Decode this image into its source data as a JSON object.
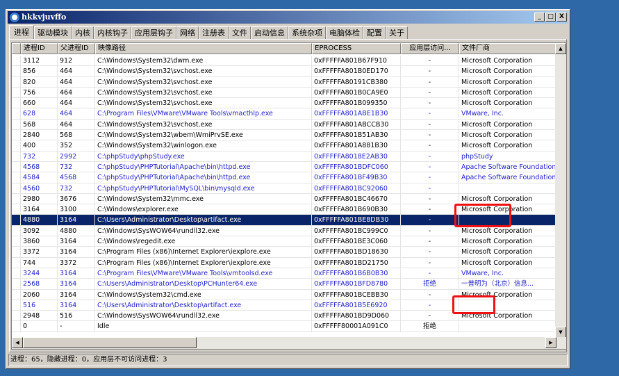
{
  "window": {
    "title": "hkkvjuvffo",
    "minimize": "_",
    "maximize": "□",
    "close": "X"
  },
  "tabs": [
    "进程",
    "驱动模块",
    "内核",
    "内核钩子",
    "应用层钩子",
    "网络",
    "注册表",
    "文件",
    "启动信息",
    "系统杂项",
    "电脑体检",
    "配置",
    "关于"
  ],
  "active_tab": 0,
  "columns": [
    "",
    "进程ID",
    "父进程ID",
    "映像路径",
    "EPROCESS",
    "应用层访问...",
    "文件厂商"
  ],
  "rows": [
    {
      "pid": "3112",
      "ppid": "912",
      "path": "C:\\Windows\\System32\\dwm.exe",
      "eprocess": "0xFFFFFA801B67F910",
      "access": "-",
      "vendor": "Microsoft Corporation",
      "style": ""
    },
    {
      "pid": "856",
      "ppid": "464",
      "path": "C:\\Windows\\System32\\svchost.exe",
      "eprocess": "0xFFFFFA801B0ED170",
      "access": "-",
      "vendor": "Microsoft Corporation",
      "style": ""
    },
    {
      "pid": "820",
      "ppid": "464",
      "path": "C:\\Windows\\System32\\svchost.exe",
      "eprocess": "0xFFFFFA80191CB380",
      "access": "-",
      "vendor": "Microsoft Corporation",
      "style": ""
    },
    {
      "pid": "756",
      "ppid": "464",
      "path": "C:\\Windows\\System32\\svchost.exe",
      "eprocess": "0xFFFFFA801B0CA9E0",
      "access": "-",
      "vendor": "Microsoft Corporation",
      "style": ""
    },
    {
      "pid": "660",
      "ppid": "464",
      "path": "C:\\Windows\\System32\\svchost.exe",
      "eprocess": "0xFFFFFA801B099350",
      "access": "-",
      "vendor": "Microsoft Corporation",
      "style": ""
    },
    {
      "pid": "628",
      "ppid": "464",
      "path": "C:\\Program Files\\VMware\\VMware Tools\\vmacthlp.exe",
      "eprocess": "0xFFFFFA801ABE1B30",
      "access": "-",
      "vendor": "VMware, Inc.",
      "style": "blue"
    },
    {
      "pid": "568",
      "ppid": "464",
      "path": "C:\\Windows\\System32\\svchost.exe",
      "eprocess": "0xFFFFFA801ABCCB30",
      "access": "-",
      "vendor": "Microsoft Corporation",
      "style": ""
    },
    {
      "pid": "2840",
      "ppid": "568",
      "path": "C:\\Windows\\System32\\wbem\\WmiPrvSE.exe",
      "eprocess": "0xFFFFFA801B51AB30",
      "access": "-",
      "vendor": "Microsoft Corporation",
      "style": ""
    },
    {
      "pid": "400",
      "ppid": "352",
      "path": "C:\\Windows\\System32\\winlogon.exe",
      "eprocess": "0xFFFFFA801A881B30",
      "access": "-",
      "vendor": "Microsoft Corporation",
      "style": ""
    },
    {
      "pid": "732",
      "ppid": "2992",
      "path": "C:\\phpStudy\\phpStudy.exe",
      "eprocess": "0xFFFFFA8018E2AB30",
      "access": "-",
      "vendor": "phpStudy",
      "style": "blue"
    },
    {
      "pid": "4568",
      "ppid": "732",
      "path": "C:\\phpStudy\\PHPTutorial\\Apache\\bin\\httpd.exe",
      "eprocess": "0xFFFFFA801BDFC060",
      "access": "-",
      "vendor": "Apache Software Foundation",
      "style": "blue"
    },
    {
      "pid": "4584",
      "ppid": "4568",
      "path": "C:\\phpStudy\\PHPTutorial\\Apache\\bin\\httpd.exe",
      "eprocess": "0xFFFFFA801BF49B30",
      "access": "-",
      "vendor": "Apache Software Foundation",
      "style": "blue"
    },
    {
      "pid": "4560",
      "ppid": "732",
      "path": "C:\\phpStudy\\PHPTutorial\\MySQL\\bin\\mysqld.exe",
      "eprocess": "0xFFFFFA801BC92060",
      "access": "-",
      "vendor": "",
      "style": "blue"
    },
    {
      "pid": "2980",
      "ppid": "3676",
      "path": "C:\\Windows\\System32\\mmc.exe",
      "eprocess": "0xFFFFFA801BC46670",
      "access": "-",
      "vendor": "Microsoft Corporation",
      "style": ""
    },
    {
      "pid": "3164",
      "ppid": "3100",
      "path": "C:\\Windows\\explorer.exe",
      "eprocess": "0xFFFFFA801B690B30",
      "access": "-",
      "vendor": "Microsoft Corporation",
      "style": ""
    },
    {
      "pid": "4880",
      "ppid": "3164",
      "path": "C:\\Users\\Administrator\\Desktop\\artifact.exe",
      "eprocess": "0xFFFFFA801BE8DB30",
      "access": "-",
      "vendor": "",
      "style": "sel"
    },
    {
      "pid": "3092",
      "ppid": "4880",
      "path": "C:\\Windows\\SysWOW64\\rundll32.exe",
      "eprocess": "0xFFFFFA801BC999C0",
      "access": "-",
      "vendor": "Microsoft Corporation",
      "style": ""
    },
    {
      "pid": "3860",
      "ppid": "3164",
      "path": "C:\\Windows\\regedit.exe",
      "eprocess": "0xFFFFFA801BE3C060",
      "access": "-",
      "vendor": "Microsoft Corporation",
      "style": ""
    },
    {
      "pid": "3372",
      "ppid": "3164",
      "path": "C:\\Program Files (x86)\\Internet Explorer\\iexplore.exe",
      "eprocess": "0xFFFFFA801BD18630",
      "access": "-",
      "vendor": "Microsoft Corporation",
      "style": ""
    },
    {
      "pid": "744",
      "ppid": "3372",
      "path": "C:\\Program Files (x86)\\Internet Explorer\\iexplore.exe",
      "eprocess": "0xFFFFFA801BD21750",
      "access": "-",
      "vendor": "Microsoft Corporation",
      "style": ""
    },
    {
      "pid": "3244",
      "ppid": "3164",
      "path": "C:\\Program Files\\VMware\\VMware Tools\\vmtoolsd.exe",
      "eprocess": "0xFFFFFA801B6B0B30",
      "access": "-",
      "vendor": "VMware, Inc.",
      "style": "blue"
    },
    {
      "pid": "2568",
      "ppid": "3164",
      "path": "C:\\Users\\Administrator\\Desktop\\PCHunter64.exe",
      "eprocess": "0xFFFFFA801BFD8780",
      "access": "拒绝",
      "vendor": "一普明为（北京）信息...",
      "style": "blue"
    },
    {
      "pid": "2060",
      "ppid": "3164",
      "path": "C:\\Windows\\System32\\cmd.exe",
      "eprocess": "0xFFFFFA801BCEBB30",
      "access": "-",
      "vendor": "Microsoft Corporation",
      "style": ""
    },
    {
      "pid": "516",
      "ppid": "3164",
      "path": "C:\\Users\\Administrator\\Desktop\\artifact.exe",
      "eprocess": "0xFFFFFA801B5E6920",
      "access": "-",
      "vendor": "",
      "style": "blue"
    },
    {
      "pid": "2948",
      "ppid": "516",
      "path": "C:\\Windows\\SysWOW64\\rundll32.exe",
      "eprocess": "0xFFFFFA801BD9D060",
      "access": "-",
      "vendor": "Microsoft Corporation",
      "style": ""
    },
    {
      "pid": "0",
      "ppid": "-",
      "path": "Idle",
      "eprocess": "0xFFFFF80001A091C0",
      "access": "拒绝",
      "vendor": "",
      "style": ""
    }
  ],
  "status": "进程：65，隐藏进程：0，应用层不可访问进程：3",
  "colors": {
    "highlight": "#f01010",
    "selected": "#0a246a",
    "signed_blue": "#2323c8"
  },
  "icons": {
    "scroll_up": "▲",
    "scroll_down": "▼",
    "scroll_left": "◀",
    "scroll_right": "▶"
  }
}
